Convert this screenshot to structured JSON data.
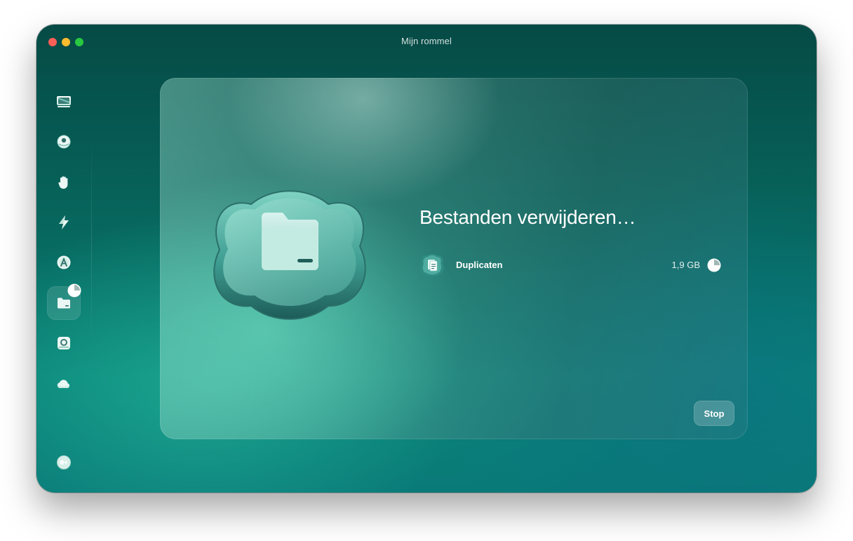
{
  "window": {
    "title": "Mijn rommel"
  },
  "colors": {
    "accent": "#0a8479",
    "traffic_close": "#fe5f57",
    "traffic_minimize": "#febc2e",
    "traffic_maximize": "#28c840"
  },
  "sidebar": {
    "items": [
      {
        "icon": "display-icon",
        "active": false
      },
      {
        "icon": "protection-icon",
        "active": false
      },
      {
        "icon": "hand-icon",
        "active": false
      },
      {
        "icon": "lightning-icon",
        "active": false
      },
      {
        "icon": "applications-icon",
        "active": false
      },
      {
        "icon": "folder-icon",
        "active": true,
        "progress": 0.25
      },
      {
        "icon": "disk-search-icon",
        "active": false
      },
      {
        "icon": "cloud-icon",
        "active": false
      }
    ],
    "footer_icon": "assistant-icon"
  },
  "main": {
    "headline": "Bestanden verwijderen…",
    "hero_icon": "folder-icon",
    "rows": [
      {
        "label": "Duplicaten",
        "size": "1,9 GB",
        "icon": "duplicate-file-icon",
        "progress": 0.25
      }
    ],
    "stop_label": "Stop"
  }
}
